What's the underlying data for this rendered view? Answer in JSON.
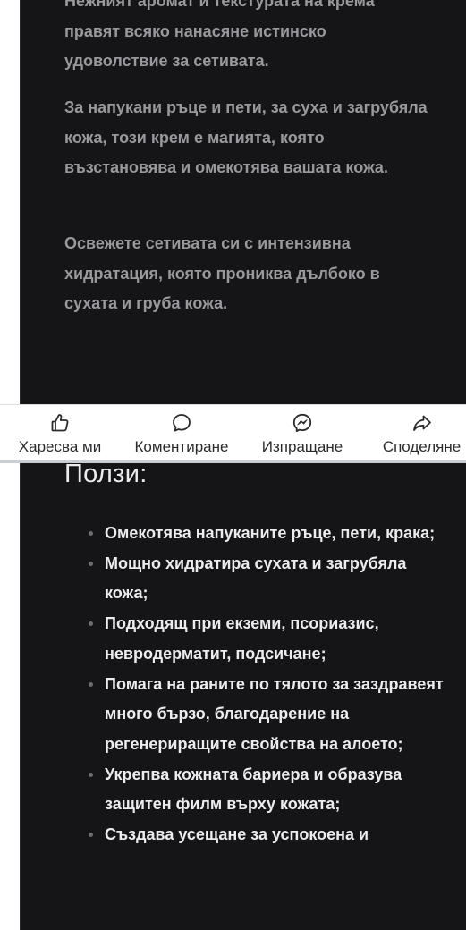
{
  "article": {
    "paragraphs": [
      "Нежният аромат и текстурата на крема правят всяко нанасяне истинско удоволствие за сетивата.",
      "За напукани ръце и пети, за суха и загрубяла кожа, този крем е магията, която възстановява и омекотява вашата кожа.",
      "Освежете сетивата си с интензивна хидратация, която прониква дълбоко в сухата и груба кожа."
    ],
    "benefits_title": "Ползи:",
    "benefits": [
      "Омекотява напуканите ръце, пети, крака;",
      "Мощно хидратира сухата и загрубяла кожа;",
      "Подходящ при екземи, псориазис, невродерматит, подсичане;",
      "Помага на раните по тялото за заздравеят много бързо, благодарение на регенериращите свойства на алоето;",
      "Укрепва кожната бариера и образува защитен филм върху кожата;",
      "Създава усещане за успокоена и"
    ]
  },
  "action_bar": {
    "like": {
      "label": "Харесва ми",
      "icon": "thumbs-up-icon"
    },
    "comment": {
      "label": "Коментиране",
      "icon": "comment-icon"
    },
    "send": {
      "label": "Изпращане",
      "icon": "messenger-icon"
    },
    "share": {
      "label": "Споделяне",
      "icon": "share-icon"
    }
  },
  "colors": {
    "article_background": "#151517",
    "body_text": "#98989d",
    "bright_text": "#ececef",
    "action_bar_background": "#ffffff",
    "action_text": "#2b2b2e"
  }
}
